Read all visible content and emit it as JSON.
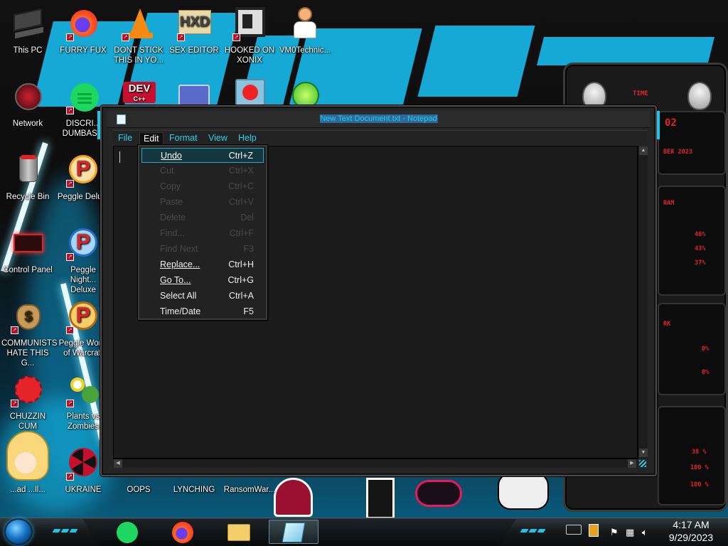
{
  "desktop": {
    "icons": [
      {
        "label": "This PC",
        "icon": "computer-icon"
      },
      {
        "label": "FURRY FUX",
        "icon": "firefox-icon"
      },
      {
        "label": "DONT STICK THIS IN YO...",
        "icon": "vlc-cone-icon"
      },
      {
        "label": "SEX EDITOR",
        "icon": "hxd-editor-icon"
      },
      {
        "label": "HOOKED ON XONIX",
        "icon": "xonix-game-icon"
      },
      {
        "label": "VM0Technic...",
        "icon": "doctor-icon"
      },
      {
        "label": "Network",
        "icon": "network-globe-icon"
      },
      {
        "label": "DISCRI... DUMBAS...",
        "icon": "chat-app-icon"
      },
      {
        "label": "Recycle Bin",
        "icon": "recycle-bin-icon"
      },
      {
        "label": "Peggle Delu...",
        "icon": "peggle-icon"
      },
      {
        "label": "Control Panel",
        "icon": "control-panel-icon"
      },
      {
        "label": "Peggle Night... Deluxe",
        "icon": "peggle-nights-icon"
      },
      {
        "label": "COMMUNISTS HATE THIS G...",
        "icon": "money-bag-icon"
      },
      {
        "label": "Peggle World of Warcraft",
        "icon": "peggle-wow-icon"
      },
      {
        "label": "CHUZZIN CUM",
        "icon": "chuzzle-icon"
      },
      {
        "label": "Plants vs Zombies",
        "icon": "pvz-icon"
      },
      {
        "label": "...ad ...ll...",
        "icon": "character-icon"
      },
      {
        "label": "UKRAINE",
        "icon": "radiation-icon"
      },
      {
        "label": "OOPS",
        "icon": "generic-icon"
      },
      {
        "label": "LYNCHING",
        "icon": "generic-icon"
      },
      {
        "label": "RansomWar...",
        "icon": "generic-icon"
      },
      {
        "label": "DEV C++",
        "icon": "devcpp-icon"
      }
    ],
    "dev_badge": "DEV",
    "dev_sub": "C++"
  },
  "gadget": {
    "header": "TIME",
    "time_digits": "02",
    "date_text": "BER 2023",
    "cpu_label": "RAM",
    "mem_label": "RK",
    "pct1": "46%",
    "pct2": "43%",
    "pct3": "37%",
    "pct4": "0%",
    "pct5": "0%",
    "pct6": "38 %",
    "pct7": "100 %",
    "pct8": "100 %"
  },
  "notepad": {
    "title": "New Text Document.txt - Notepad",
    "menus": [
      "File",
      "Edit",
      "Format",
      "View",
      "Help"
    ],
    "active_menu": "Edit",
    "content": ""
  },
  "edit_menu": {
    "items": [
      {
        "label": "Undo",
        "shortcut": "Ctrl+Z",
        "enabled": true,
        "highlighted": true
      },
      {
        "label": "Cut",
        "shortcut": "Ctrl+X",
        "enabled": false
      },
      {
        "label": "Copy",
        "shortcut": "Ctrl+C",
        "enabled": false
      },
      {
        "label": "Paste",
        "shortcut": "Ctrl+V",
        "enabled": false
      },
      {
        "label": "Delete",
        "shortcut": "Del",
        "enabled": false
      },
      {
        "label": "Find...",
        "shortcut": "Ctrl+F",
        "enabled": false
      },
      {
        "label": "Find Next",
        "shortcut": "F3",
        "enabled": false
      },
      {
        "label": "Replace...",
        "shortcut": "Ctrl+H",
        "enabled": true
      },
      {
        "label": "Go To...",
        "shortcut": "Ctrl+G",
        "enabled": true
      },
      {
        "label": "Select All",
        "shortcut": "Ctrl+A",
        "enabled": true
      },
      {
        "label": "Time/Date",
        "shortcut": "F5",
        "enabled": true
      }
    ]
  },
  "taskbar": {
    "pinned": [
      "chat-app-icon",
      "firefox-icon",
      "file-explorer-icon",
      "notepad-icon"
    ],
    "clock_time": "4:17 AM",
    "clock_date": "9/29/2023",
    "tray_icons": [
      "keyboard-icon",
      "flag-icon",
      "network-icon",
      "volume-icon"
    ]
  },
  "colors": {
    "accent": "#2ad0f0",
    "highlight_border": "#2aa6c2",
    "disabled_text": "#4a4a4a",
    "gadget_red": "#e0242b"
  }
}
